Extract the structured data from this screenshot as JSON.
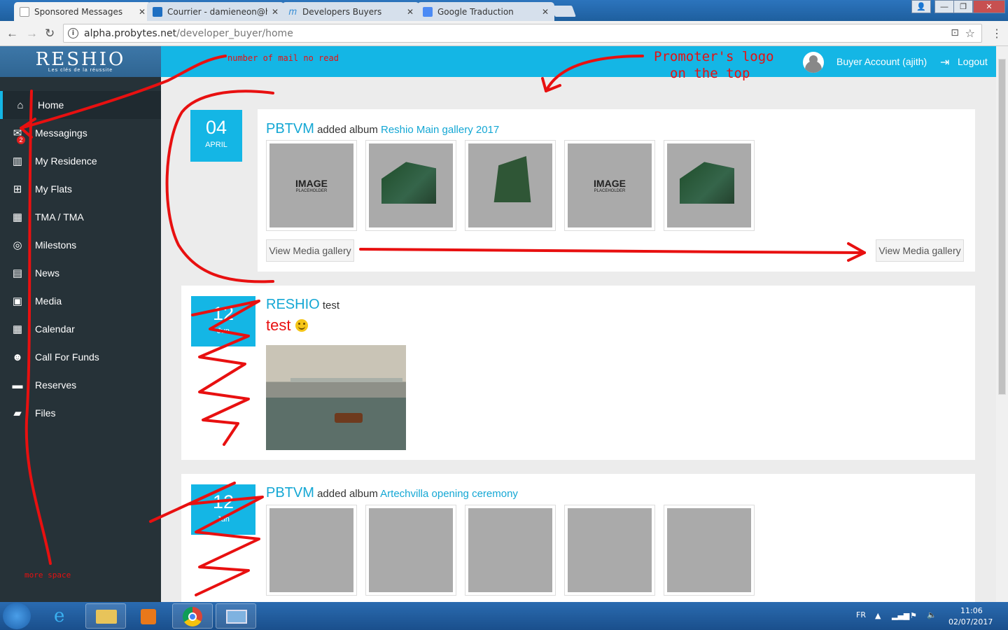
{
  "browser": {
    "tabs": [
      {
        "title": "Sponsored Messages",
        "favicon_color": "#ffffff"
      },
      {
        "title": "Courrier - damieneon@h",
        "favicon_color": "#1e6fc2"
      },
      {
        "title": "Developers Buyers",
        "favicon_color": "#3a8fd6"
      },
      {
        "title": "Google Traduction",
        "favicon_color": "#4c8bf5"
      }
    ],
    "url_host": "alpha.probytes.net",
    "url_path": "/developer_buyer/home"
  },
  "app": {
    "logo": "RESHIO",
    "logo_tagline": "Les clés de la réussite",
    "account_label": "Buyer Account (ajith)",
    "logout_label": "Logout",
    "accent_color": "#14b6e5"
  },
  "sidebar": {
    "items": [
      {
        "label": "Home",
        "icon": "home-icon",
        "glyph": "⌂"
      },
      {
        "label": "Messagings",
        "icon": "envelope-icon",
        "glyph": "✉",
        "badge": "2"
      },
      {
        "label": "My Residence",
        "icon": "building-icon",
        "glyph": "⌂"
      },
      {
        "label": "My Flats",
        "icon": "grid-icon",
        "glyph": "⊞"
      },
      {
        "label": "TMA / TMA",
        "icon": "tools-icon",
        "glyph": "▦"
      },
      {
        "label": "Milestons",
        "icon": "target-icon",
        "glyph": "◎"
      },
      {
        "label": "News",
        "icon": "newspaper-icon",
        "glyph": "▤"
      },
      {
        "label": "Media",
        "icon": "image-icon",
        "glyph": "▣"
      },
      {
        "label": "Calendar",
        "icon": "calendar-icon",
        "glyph": "▦"
      },
      {
        "label": "Call For Funds",
        "icon": "users-icon",
        "glyph": "☻"
      },
      {
        "label": "Reserves",
        "icon": "card-icon",
        "glyph": "▬"
      },
      {
        "label": "Files",
        "icon": "folder-icon",
        "glyph": "▰"
      }
    ]
  },
  "feed": {
    "posts": [
      {
        "day": "04",
        "month": "APRIL",
        "author": "PBTVM",
        "action": "added album",
        "album": "Reshio Main gallery 2017",
        "thumb_placeholder_title": "IMAGE",
        "thumb_placeholder_sub": "PLACEHOLDER",
        "button_left": "View Media gallery",
        "button_right": "View Media gallery"
      },
      {
        "day": "12",
        "month": "Jun",
        "author": "RESHIO",
        "action": "test",
        "body": "test"
      },
      {
        "day": "12",
        "month": "Jun",
        "author": "PBTVM",
        "action": "added album",
        "album": "Artechvilla opening ceremony"
      }
    ]
  },
  "annotations": {
    "mail_note": "number of mail no read",
    "logo_note_line1": "Promoter's logo",
    "logo_note_line2": "on the top",
    "space_note": "more space",
    "ink_color": "#e81010"
  },
  "taskbar": {
    "lang": "FR",
    "time": "11:06",
    "date": "02/07/2017"
  }
}
